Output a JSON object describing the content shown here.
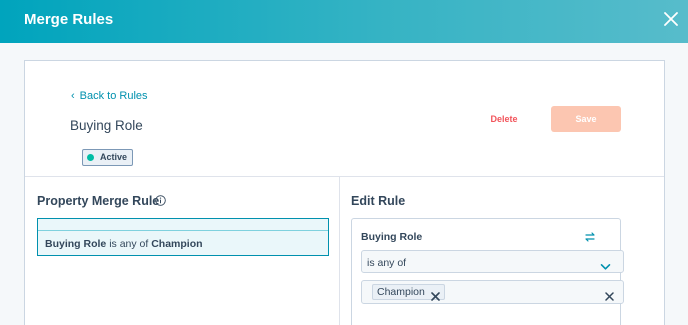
{
  "header": {
    "title": "Merge Rules",
    "close_icon": "close-icon"
  },
  "top": {
    "back_label": "Back to Rules",
    "record_title": "Buying Role",
    "status": {
      "label": "Active",
      "color": "#00bda5"
    },
    "delete_label": "Delete",
    "save_label": "Save"
  },
  "property_merge_rule": {
    "title": "Property Merge Rule",
    "rule": {
      "property": "Buying Role",
      "operator": "is any of",
      "value": "Champion"
    }
  },
  "edit_rule": {
    "title": "Edit Rule",
    "property": "Buying Role",
    "operator_selected": "is any of",
    "values": [
      "Champion"
    ]
  },
  "colors": {
    "header_start": "#00a4bd",
    "link": "#0091ae",
    "delete": "#f2545b",
    "save_disabled": "#fcc6b1"
  }
}
